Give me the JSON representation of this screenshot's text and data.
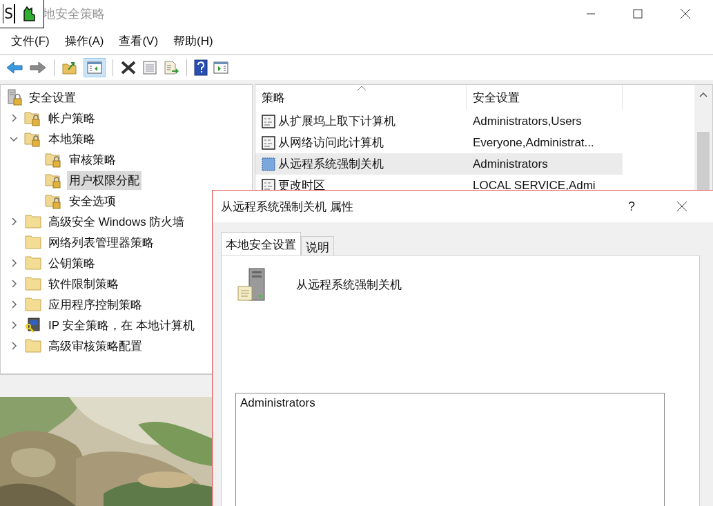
{
  "overlay": {
    "label": "S"
  },
  "window": {
    "title": "地安全策略"
  },
  "menu": [
    "文件(F)",
    "操作(A)",
    "查看(V)",
    "帮助(H)"
  ],
  "toolbar": {
    "tree_toggle_on": true
  },
  "tree": [
    {
      "label": "安全设置",
      "kind": "root",
      "selected": false,
      "children": [
        {
          "label": "帐户策略",
          "kind": "locked",
          "expanded": false,
          "selected": false
        },
        {
          "label": "本地策略",
          "kind": "locked",
          "expanded": true,
          "selected": false,
          "children": [
            {
              "label": "审核策略",
              "kind": "locked",
              "selected": false
            },
            {
              "label": "用户权限分配",
              "kind": "locked",
              "selected": true
            },
            {
              "label": "安全选项",
              "kind": "locked",
              "selected": false
            }
          ]
        },
        {
          "label": "高级安全 Windows 防火墙",
          "kind": "folder",
          "expanded": false,
          "selected": false
        },
        {
          "label": "网络列表管理器策略",
          "kind": "folder",
          "selected": false
        },
        {
          "label": "公钥策略",
          "kind": "folder",
          "expanded": false,
          "selected": false
        },
        {
          "label": "软件限制策略",
          "kind": "folder",
          "expanded": false,
          "selected": false
        },
        {
          "label": "应用程序控制策略",
          "kind": "folder",
          "expanded": false,
          "selected": false
        },
        {
          "label": "IP 安全策略，在 本地计算机",
          "kind": "ip",
          "expanded": false,
          "selected": false
        },
        {
          "label": "高级审核策略配置",
          "kind": "folder",
          "expanded": false,
          "selected": false
        }
      ]
    }
  ],
  "table": {
    "columns": [
      {
        "label": "策略",
        "sorted": true
      },
      {
        "label": "安全设置",
        "sorted": false
      }
    ],
    "rows": [
      {
        "policy": "从扩展坞上取下计算机",
        "setting": "Administrators,Users",
        "selected": false
      },
      {
        "policy": "从网络访问此计算机",
        "setting": "Everyone,Administrat...",
        "selected": false
      },
      {
        "policy": "从远程系统强制关机",
        "setting": "Administrators",
        "selected": true
      },
      {
        "policy": "更改时区",
        "setting": "LOCAL SERVICE,Admi",
        "selected": false
      }
    ]
  },
  "dialog": {
    "title": "从远程系统强制关机 属性",
    "help": "?",
    "tabs": [
      {
        "label": "本地安全设置",
        "selected": true
      },
      {
        "label": "说明",
        "selected": false
      }
    ],
    "policy_name": "从远程系统强制关机",
    "members": [
      "Administrators"
    ]
  }
}
